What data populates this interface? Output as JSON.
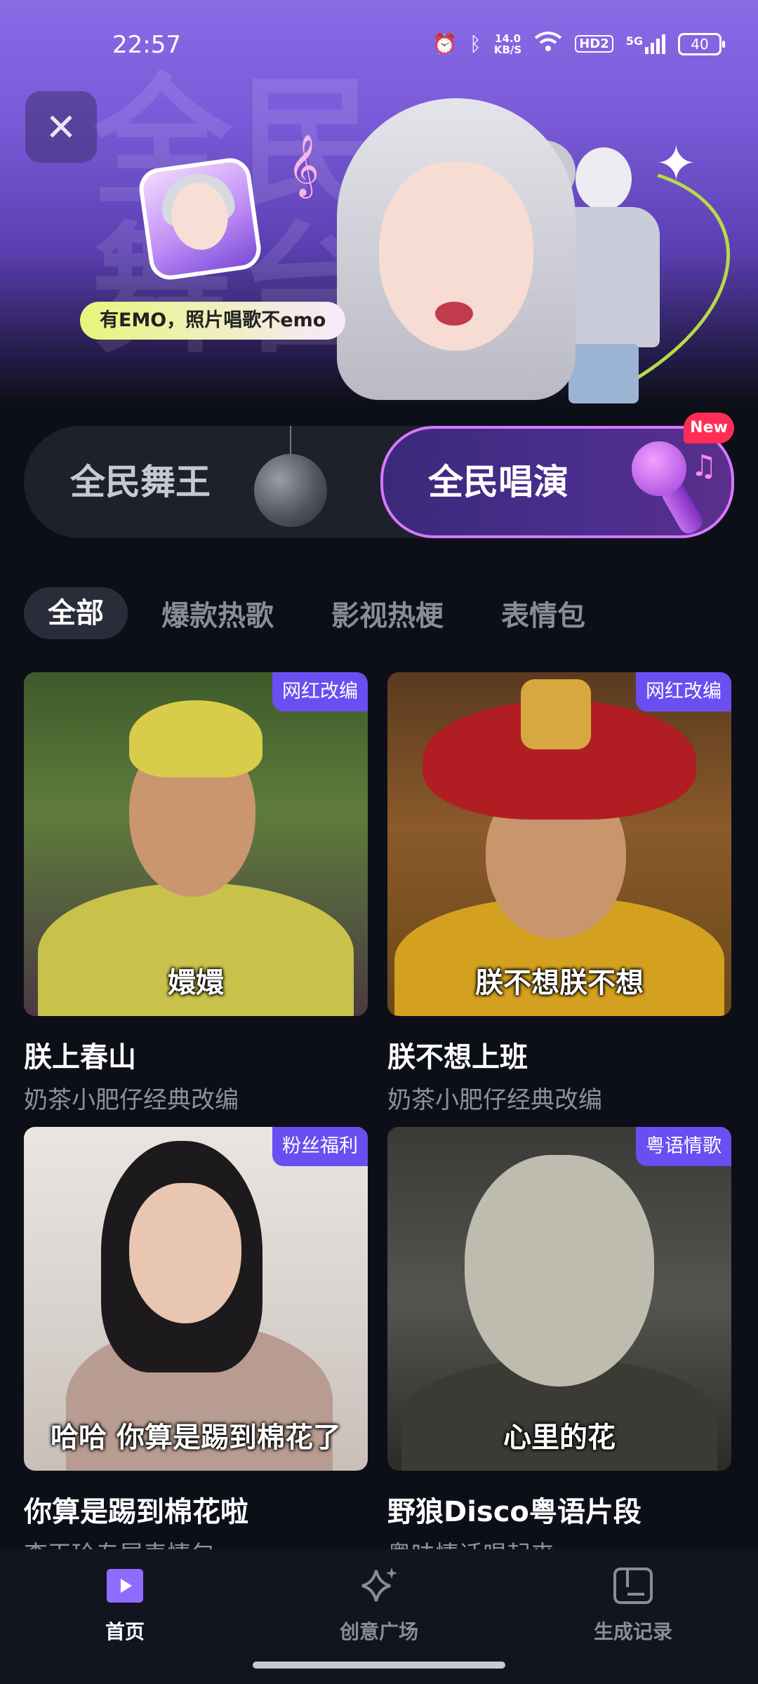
{
  "status_bar": {
    "time": "22:57",
    "network_speed_value": "14.0",
    "network_speed_unit": "KB/S",
    "hd_label": "HD2",
    "signal_label": "5G",
    "battery": "40"
  },
  "banner": {
    "background_chars": "全民舞台",
    "slogan": "有EMO，照片唱歌不emo",
    "accent_color": "#7a5ad8"
  },
  "mode_switch": {
    "left_label": "全民舞王",
    "right_label": "全民唱演",
    "new_badge": "New"
  },
  "tabs": [
    {
      "label": "全部",
      "active": true
    },
    {
      "label": "爆款热歌",
      "active": false
    },
    {
      "label": "影视热梗",
      "active": false
    },
    {
      "label": "表情包",
      "active": false
    }
  ],
  "cards": [
    {
      "tag": "网红改编",
      "caption": "嬛嬛",
      "title": "朕上春山",
      "subtitle": "奶茶小肥仔经典改编"
    },
    {
      "tag": "网红改编",
      "caption": "朕不想朕不想",
      "title": "朕不想上班",
      "subtitle": "奶茶小肥仔经典改编"
    },
    {
      "tag": "粉丝福利",
      "caption": "哈哈  你算是踢到棉花了",
      "title": "你算是踢到棉花啦",
      "subtitle": "李玉玲专属表情包"
    },
    {
      "tag": "粤语情歌",
      "caption": "心里的花",
      "title": "野狼Disco粤语片段",
      "subtitle": "粤味情话唱起来"
    }
  ],
  "bottom_nav": [
    {
      "label": "首页",
      "icon": "play-icon",
      "active": true
    },
    {
      "label": "创意广场",
      "icon": "sparkle-icon",
      "active": false
    },
    {
      "label": "生成记录",
      "icon": "record-icon",
      "active": false
    }
  ],
  "colors": {
    "tag_bg": "#6a4ef2",
    "new_badge_bg": "#ff2d55",
    "active_nav": "#8f6bff"
  }
}
